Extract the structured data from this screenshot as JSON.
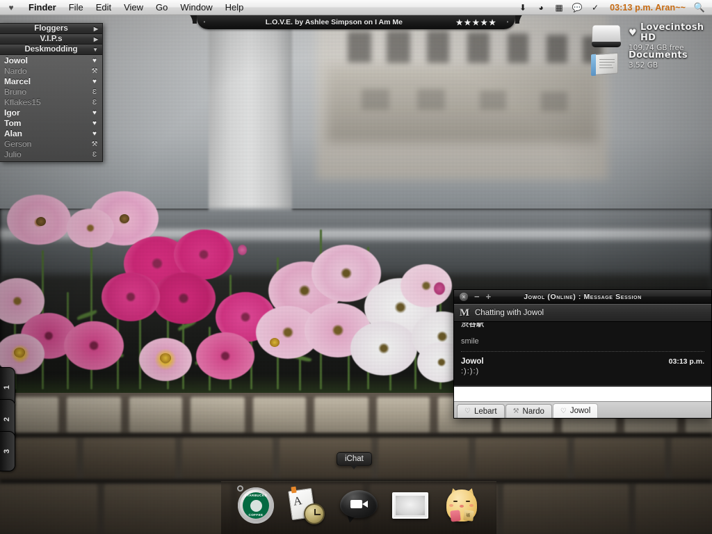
{
  "menubar": {
    "apple_icon": "heart-icon",
    "app_name": "Finder",
    "menus": [
      "File",
      "Edit",
      "View",
      "Go",
      "Window",
      "Help"
    ],
    "status_icons": [
      "download-icon",
      "volume-icon",
      "display-icon",
      "chat-icon",
      "check-icon"
    ],
    "clock": "03:13 p.m. Aran~~",
    "clock_color": "#c66a12",
    "search_icon": "search-icon"
  },
  "itunes": {
    "track": "L.O.V.E. by Ashlee Simpson on I Am Me",
    "rating": "★★★★★",
    "left_dot": "•",
    "right_dot": "•"
  },
  "buddylist": {
    "groups": [
      {
        "label": "Floggers",
        "arrow": "▶"
      },
      {
        "label": "V.I.P.s",
        "arrow": "▶"
      },
      {
        "label": "Deskmodding",
        "arrow": "▼"
      }
    ],
    "buddies": [
      {
        "name": "Jowol",
        "status": "♥",
        "online": true
      },
      {
        "name": "Nardo",
        "status": "⚒",
        "online": false
      },
      {
        "name": "Marcel",
        "status": "♥",
        "online": true
      },
      {
        "name": "Bruno",
        "status": "Ɛ",
        "online": false
      },
      {
        "name": "Kflakes15",
        "status": "Ɛ",
        "online": false
      },
      {
        "name": "Igor",
        "status": "♥",
        "online": true
      },
      {
        "name": "Tom",
        "status": "♥",
        "online": true
      },
      {
        "name": "Alan",
        "status": "♥",
        "online": true
      },
      {
        "name": "Gerson",
        "status": "⚒",
        "online": false
      },
      {
        "name": "Julio",
        "status": "Ɛ",
        "online": false
      }
    ]
  },
  "desktop_icons": [
    {
      "icon": "hard-drive-icon",
      "heart": "♥",
      "name": "Lovecintosh HD",
      "sub": "109.74 GB free"
    },
    {
      "icon": "documents-folder-icon",
      "heart": "",
      "name": "Documents",
      "sub": "3.52 GB"
    }
  ],
  "spaces": [
    {
      "label": "1"
    },
    {
      "label": "2"
    },
    {
      "label": "3"
    }
  ],
  "ichat": {
    "title": "Jowol (Online) : Message Session",
    "close_icon": "×",
    "minimize_icon": "−",
    "zoom_icon": "+",
    "subheader_icon": "M",
    "subheader": "Chatting with Jowol",
    "messages": [
      {
        "sender": "",
        "time": "",
        "text": "smile",
        "clipped": true
      },
      {
        "sender": "Jowol",
        "time": "03:13 p.m.",
        "text": ":):):)"
      }
    ],
    "input_value": "",
    "tabs": [
      {
        "label": "Lebart",
        "status": "♡",
        "active": false
      },
      {
        "label": "Nardo",
        "status": "⚒",
        "active": false
      },
      {
        "label": "Jowol",
        "status": "♡",
        "active": true
      }
    ]
  },
  "dock": {
    "tooltip": "iChat",
    "items": [
      {
        "name": "starbucks-icon",
        "label": "Starbucks",
        "line1": "STARBUCKS",
        "line2": "COFFEE"
      },
      {
        "name": "notepad-clock-icon",
        "label": "Dashboard",
        "letter": "A"
      },
      {
        "name": "ichat-icon",
        "label": "iChat"
      },
      {
        "name": "display-preferences-icon",
        "label": "Displays",
        "glyph": ""
      },
      {
        "name": "lucky-cat-icon",
        "label": "Maneki Neko",
        "coin": "福"
      }
    ]
  }
}
